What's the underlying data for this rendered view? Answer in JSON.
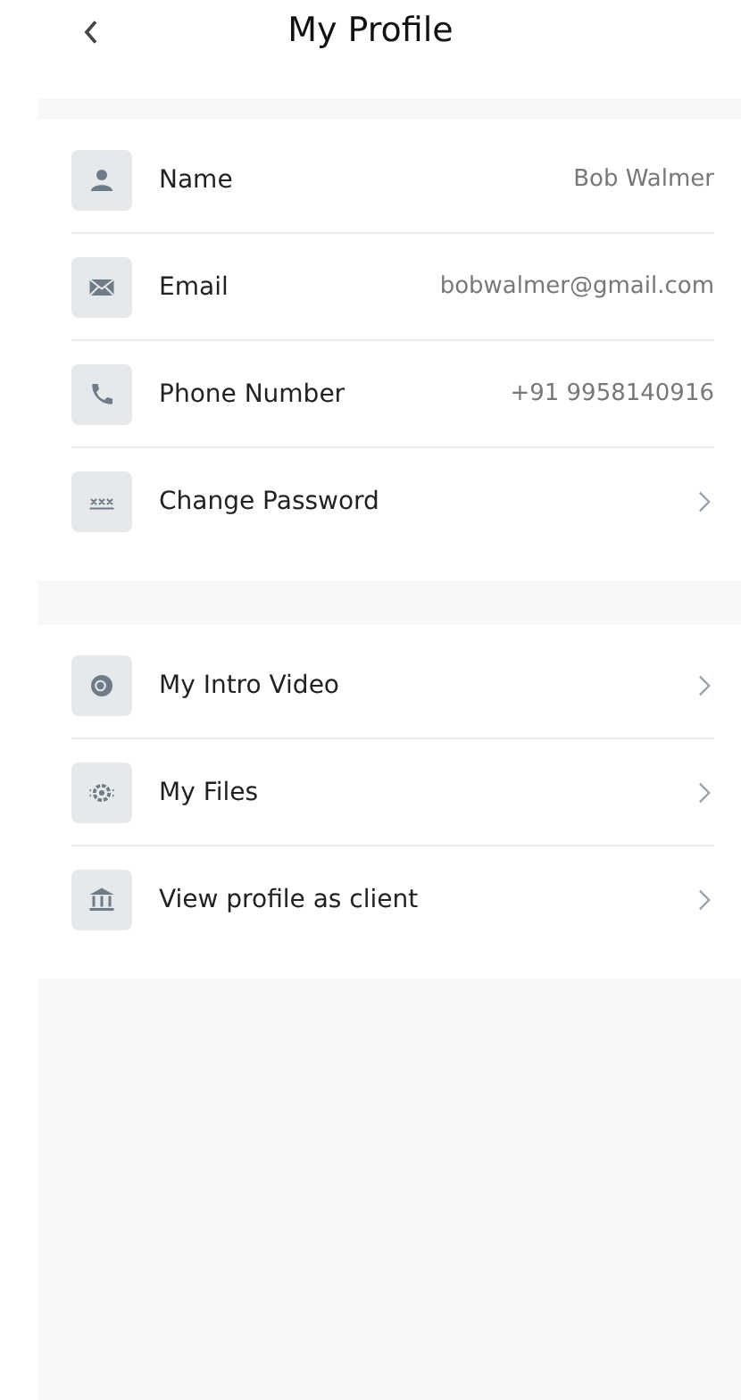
{
  "header": {
    "title": "My Profile"
  },
  "sections": [
    {
      "rows": [
        {
          "kind": "value",
          "label": "Name",
          "value": "Bob Walmer"
        },
        {
          "kind": "value",
          "label": "Email",
          "value": "bobwalmer@gmail.com"
        },
        {
          "kind": "value",
          "label": "Phone Number",
          "value": "+91 9958140916"
        },
        {
          "kind": "link",
          "label": "Change Password"
        }
      ]
    },
    {
      "rows": [
        {
          "kind": "link",
          "label": "My Intro Video"
        },
        {
          "kind": "link",
          "label": "My Files"
        },
        {
          "kind": "link",
          "label": "View profile as client"
        }
      ]
    }
  ]
}
